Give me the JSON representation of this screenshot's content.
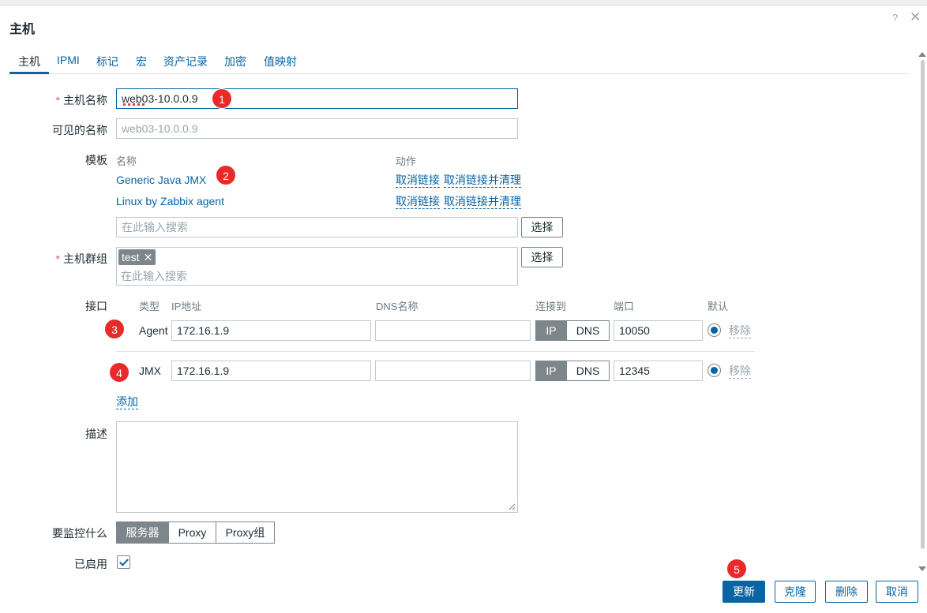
{
  "dialog": {
    "title": "主机"
  },
  "tabs": [
    {
      "label": "主机"
    },
    {
      "label": "IPMI"
    },
    {
      "label": "标记"
    },
    {
      "label": "宏"
    },
    {
      "label": "资产记录"
    },
    {
      "label": "加密"
    },
    {
      "label": "值映射"
    }
  ],
  "form": {
    "host_name": {
      "label": "主机名称",
      "value": "web03-10.0.0.9"
    },
    "visible_name": {
      "label": "可见的名称",
      "placeholder": "web03-10.0.0.9"
    },
    "templates": {
      "label": "模板",
      "col_name": "名称",
      "col_action": "动作",
      "rows": [
        {
          "name": "Generic Java JMX",
          "unlink": "取消链接",
          "unlink_clear": "取消链接并清理"
        },
        {
          "name": "Linux by Zabbix agent",
          "unlink": "取消链接",
          "unlink_clear": "取消链接并清理"
        }
      ],
      "search_placeholder": "在此输入搜索",
      "select_label": "选择"
    },
    "host_groups": {
      "label": "主机群组",
      "tags": [
        "test"
      ],
      "search_placeholder": "在此输入搜索",
      "select_label": "选择"
    },
    "interfaces": {
      "label": "接口",
      "col_type": "类型",
      "col_ip": "IP地址",
      "col_dns": "DNS名称",
      "col_connect": "连接到",
      "col_port": "端口",
      "col_default": "默认",
      "rows": [
        {
          "type": "Agent",
          "ip": "172.16.1.9",
          "dns": "",
          "ip_btn": "IP",
          "dns_btn": "DNS",
          "port": "10050",
          "remove": "移除"
        },
        {
          "type": "JMX",
          "ip": "172.16.1.9",
          "dns": "",
          "ip_btn": "IP",
          "dns_btn": "DNS",
          "port": "12345",
          "remove": "移除"
        }
      ],
      "add_label": "添加"
    },
    "description": {
      "label": "描述",
      "value": ""
    },
    "monitored_by": {
      "label": "要监控什么",
      "options": [
        "服务器",
        "Proxy",
        "Proxy组"
      ],
      "selected": "服务器"
    },
    "enabled": {
      "label": "已启用",
      "checked": true
    }
  },
  "footer": {
    "update": "更新",
    "clone": "克隆",
    "delete": "删除",
    "cancel": "取消"
  },
  "annotations": [
    "1",
    "2",
    "3",
    "4",
    "5"
  ],
  "colors": {
    "accent": "#0a64a3",
    "required": "#e45959",
    "badge": "#e82a2a",
    "segment_on": "#7d868b"
  }
}
